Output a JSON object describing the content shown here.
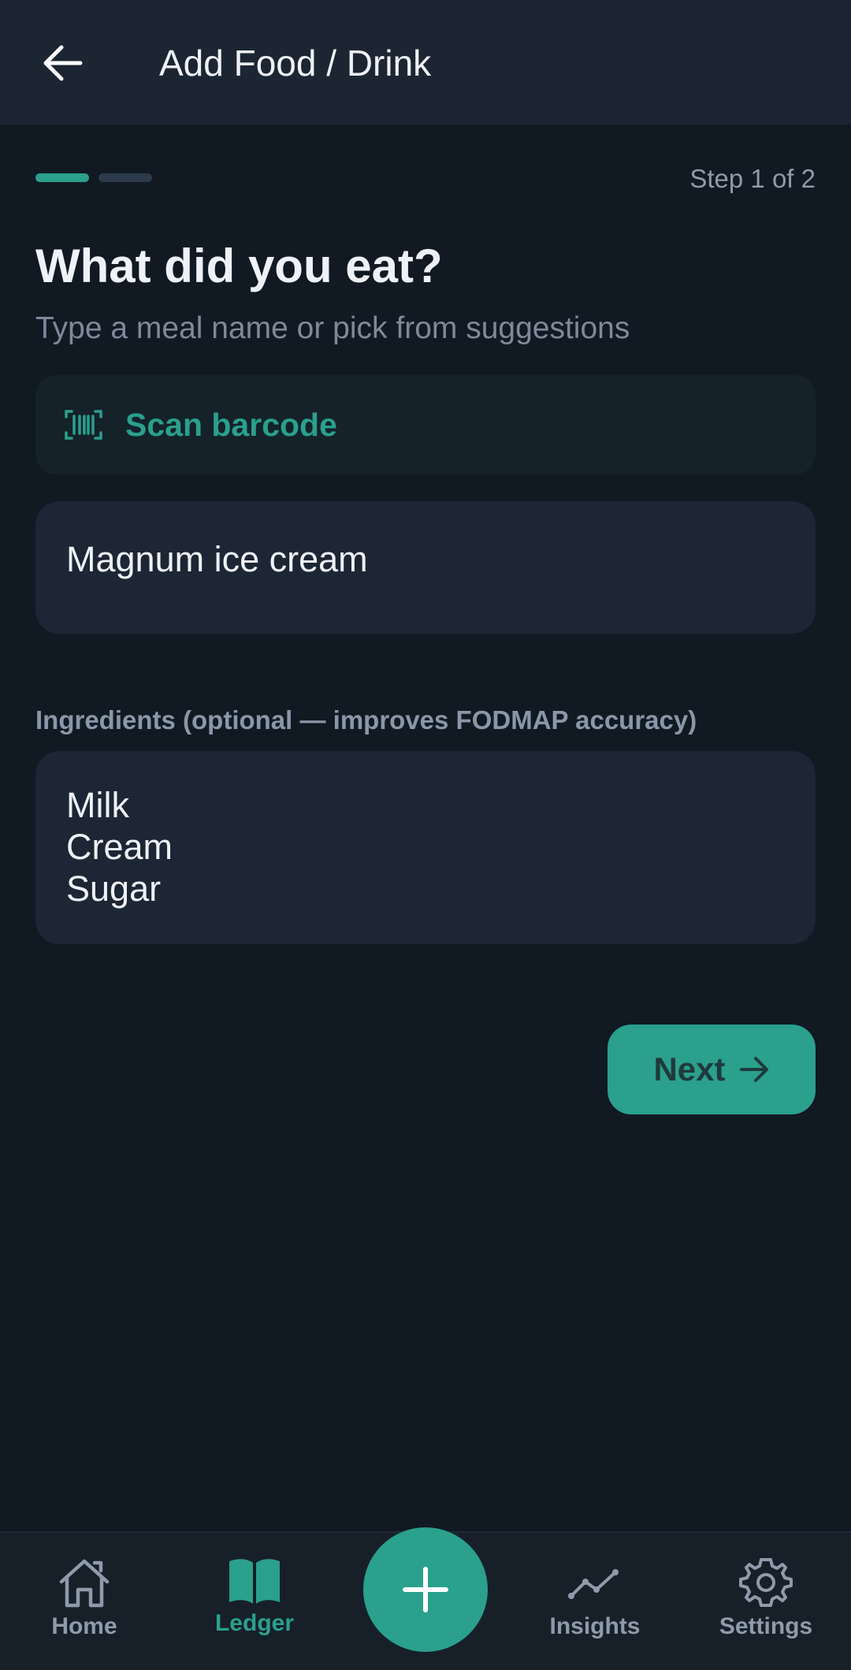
{
  "header": {
    "title": "Add Food / Drink",
    "back_icon": "arrow-left-icon"
  },
  "progress": {
    "current_step": 1,
    "total_steps": 2,
    "step_text": "Step 1 of 2",
    "accent_color": "#2aa08d"
  },
  "form": {
    "heading": "What did you eat?",
    "subheading": "Type a meal name or pick from suggestions",
    "scan_button": {
      "label": "Scan barcode",
      "icon": "barcode-icon"
    },
    "meal_input_value": "Magnum ice cream",
    "ingredients_label": "Ingredients (optional — improves FODMAP accuracy)",
    "ingredients": [
      "Milk",
      "Cream",
      "Sugar"
    ],
    "next_button": {
      "label": "Next",
      "icon": "arrow-right-icon"
    }
  },
  "bottom_nav": {
    "items": [
      {
        "label": "Home",
        "icon": "home-icon",
        "active": false
      },
      {
        "label": "Ledger",
        "icon": "book-icon",
        "active": true
      },
      {
        "label": "Insights",
        "icon": "line-chart-icon",
        "active": false
      },
      {
        "label": "Settings",
        "icon": "gear-icon",
        "active": false
      }
    ],
    "fab_icon": "plus-icon"
  }
}
